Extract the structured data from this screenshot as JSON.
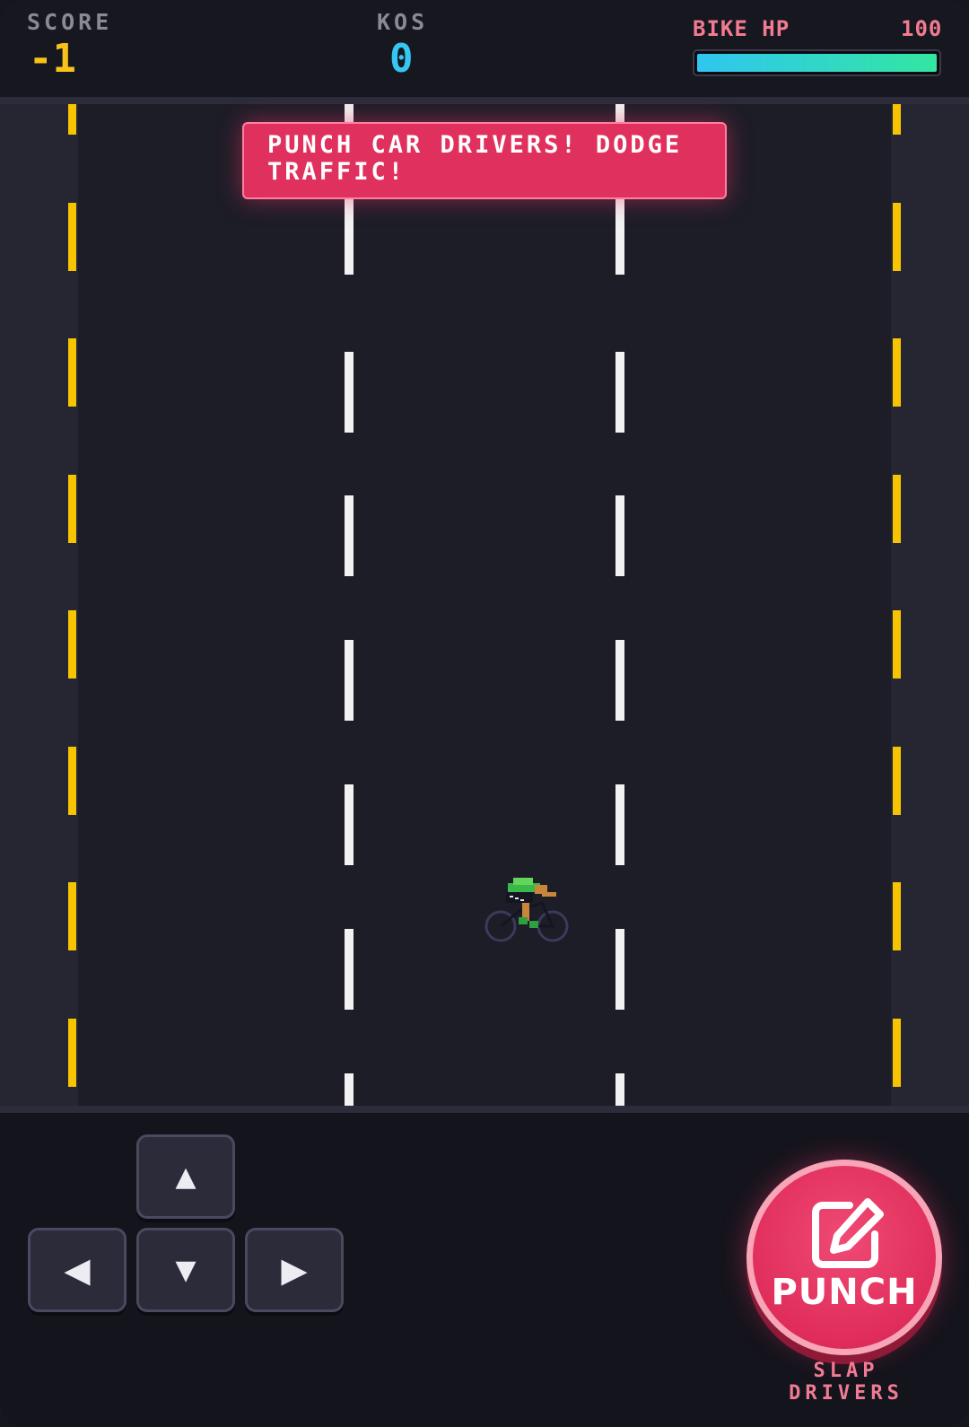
{
  "hud": {
    "score_label": "SCORE",
    "score_value": "-1",
    "kos_label": "KOS",
    "kos_value": "0",
    "hp_label": "BIKE HP",
    "hp_value": "100",
    "hp_fraction": 1.0
  },
  "banner": {
    "text": "PUNCH CAR DRIVERS! DODGE TRAFFIC!"
  },
  "controls": {
    "up": "▲",
    "left": "◀",
    "down": "▼",
    "right": "▶",
    "punch_label": "PUNCH",
    "punch_icon": "edit-icon",
    "punch_sub": "SLAP DRIVERS"
  },
  "colors": {
    "score": "#f7c319",
    "kos": "#35c6f2",
    "hp_text": "#f07b92",
    "edge_line": "#f7c400",
    "lane_line": "#f2f2f2",
    "accent": "#e0315e"
  }
}
